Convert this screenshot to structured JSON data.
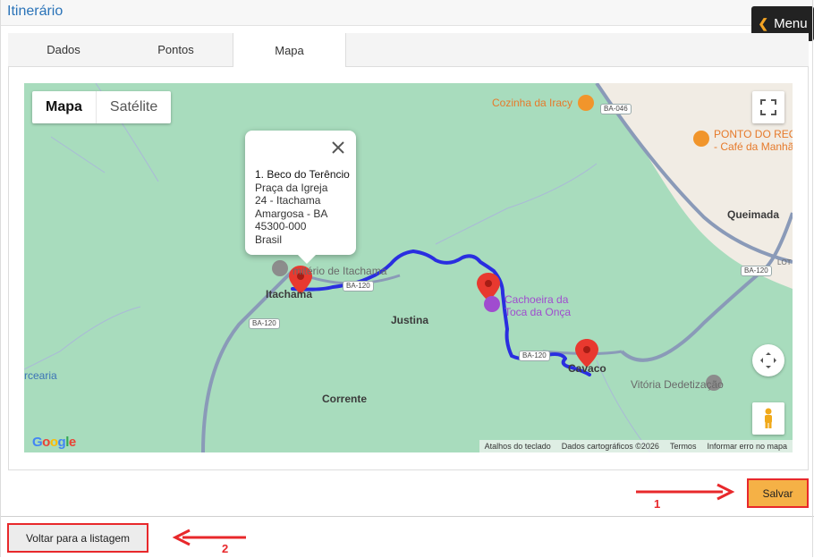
{
  "header": {
    "title": "Itinerário",
    "menu_label": "Menu"
  },
  "tabs": [
    {
      "label": "Dados",
      "active": false
    },
    {
      "label": "Pontos",
      "active": false
    },
    {
      "label": "Mapa",
      "active": true
    }
  ],
  "map": {
    "type_options": [
      "Mapa",
      "Satélite"
    ],
    "selected_type": "Mapa",
    "infowindow": {
      "name": "1. Beco do Terêncio",
      "line1": "Praça da Igreja",
      "line2": "24 - Itachama",
      "line3": "Amargosa - BA",
      "line4": "45300-000",
      "line5": "Brasil"
    },
    "places": {
      "cozinha": "Cozinha da Iracy",
      "ponto": "PONTO DO REQ",
      "cafe": "- Café da Manhã",
      "queimada": "Queimada",
      "cemiterio": "mitério de Itachama",
      "itachama": "Itachama",
      "justina": "Justina",
      "cachoeira1": "Cachoeira da",
      "cachoeira2": "Toca da Onça",
      "cavaco": "Cavaco",
      "vitoria": "Vitória Dedetização",
      "corrente": "Corrente",
      "arceria": "rcearia",
      "lot": "LOT"
    },
    "roads": {
      "ba046": "BA-046",
      "ba120_a": "BA-120",
      "ba120_b": "BA-120",
      "ba120_c": "BA-120",
      "ba120_d": "BA-120"
    },
    "attribution": [
      "Atalhos do teclado",
      "Dados cartográficos ©2026",
      "Termos",
      "Informar erro no mapa"
    ],
    "logo": "Google"
  },
  "actions": {
    "save_label": "Salvar",
    "back_label": "Voltar para a listagem"
  },
  "annotations": {
    "one": "1",
    "two": "2"
  },
  "colors": {
    "accent": "#f5b146",
    "route": "#2a2ee0",
    "highlight": "#e8282b",
    "title": "#2a73b8"
  }
}
